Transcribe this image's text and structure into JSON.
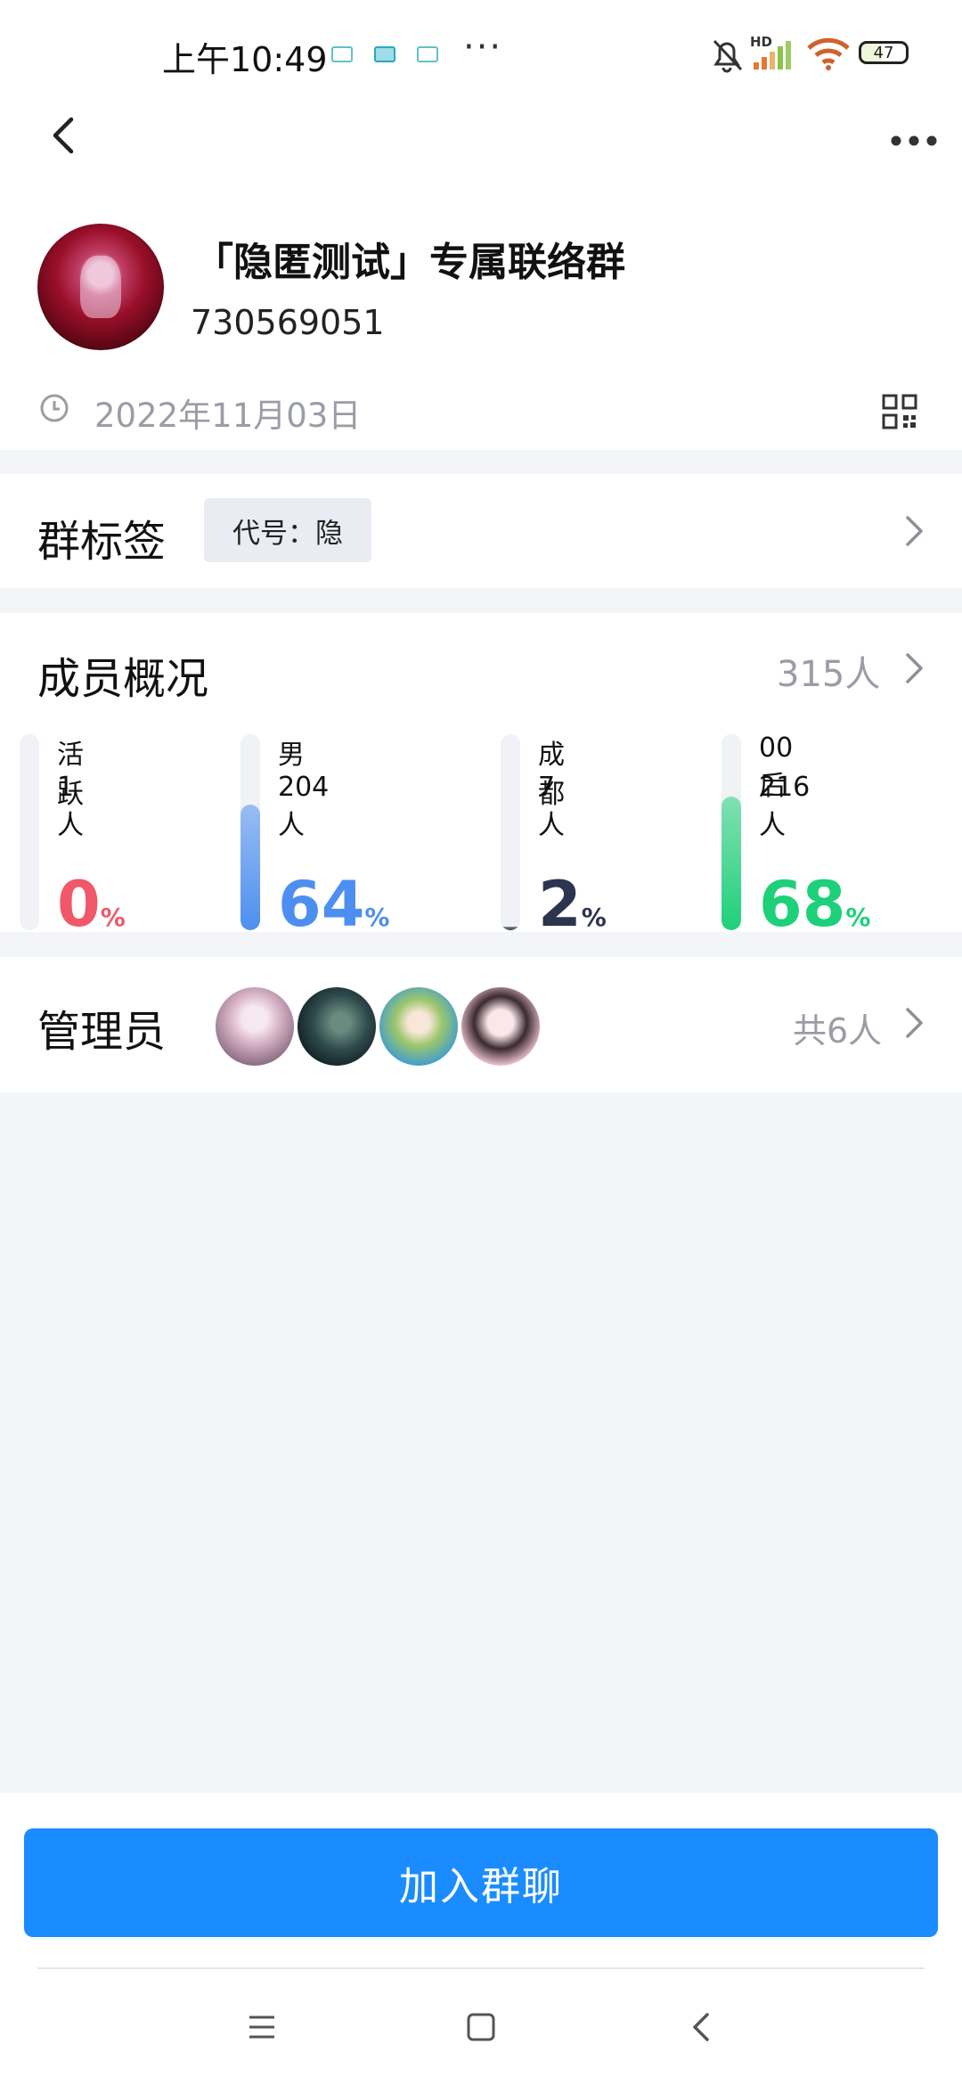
{
  "status_bar": {
    "time": "上午10:49",
    "more": "···",
    "battery": "47",
    "hd": "HD"
  },
  "header": {
    "group_name": "「隐匿测试」专属联络群",
    "group_id": "730569051",
    "created_date": "2022年11月03日"
  },
  "tags": {
    "title": "群标签",
    "chip": "代号：隐"
  },
  "members": {
    "title": "成员概况",
    "count": "315人",
    "stats": [
      {
        "label": "活跃",
        "count": "1人",
        "pct": "0",
        "fill": 0.0,
        "color": "#f0586a"
      },
      {
        "label": "男",
        "count": "204人",
        "pct": "64",
        "fill": 0.64,
        "color": "#4d8ff0"
      },
      {
        "label": "成都",
        "count": "7人",
        "pct": "2",
        "fill": 0.02,
        "color": "#2c3450"
      },
      {
        "label": "00后",
        "count": "216人",
        "pct": "68",
        "fill": 0.68,
        "color": "#1fd07a"
      }
    ],
    "pct_sign": "%"
  },
  "admins": {
    "title": "管理员",
    "count": "共6人"
  },
  "actions": {
    "join": "加入群聊"
  },
  "icons": {
    "back": "back-arrow-icon",
    "more": "more-dots-icon",
    "clock": "clock-icon",
    "qr": "qr-code-icon",
    "chevron": "chevron-right-icon"
  }
}
